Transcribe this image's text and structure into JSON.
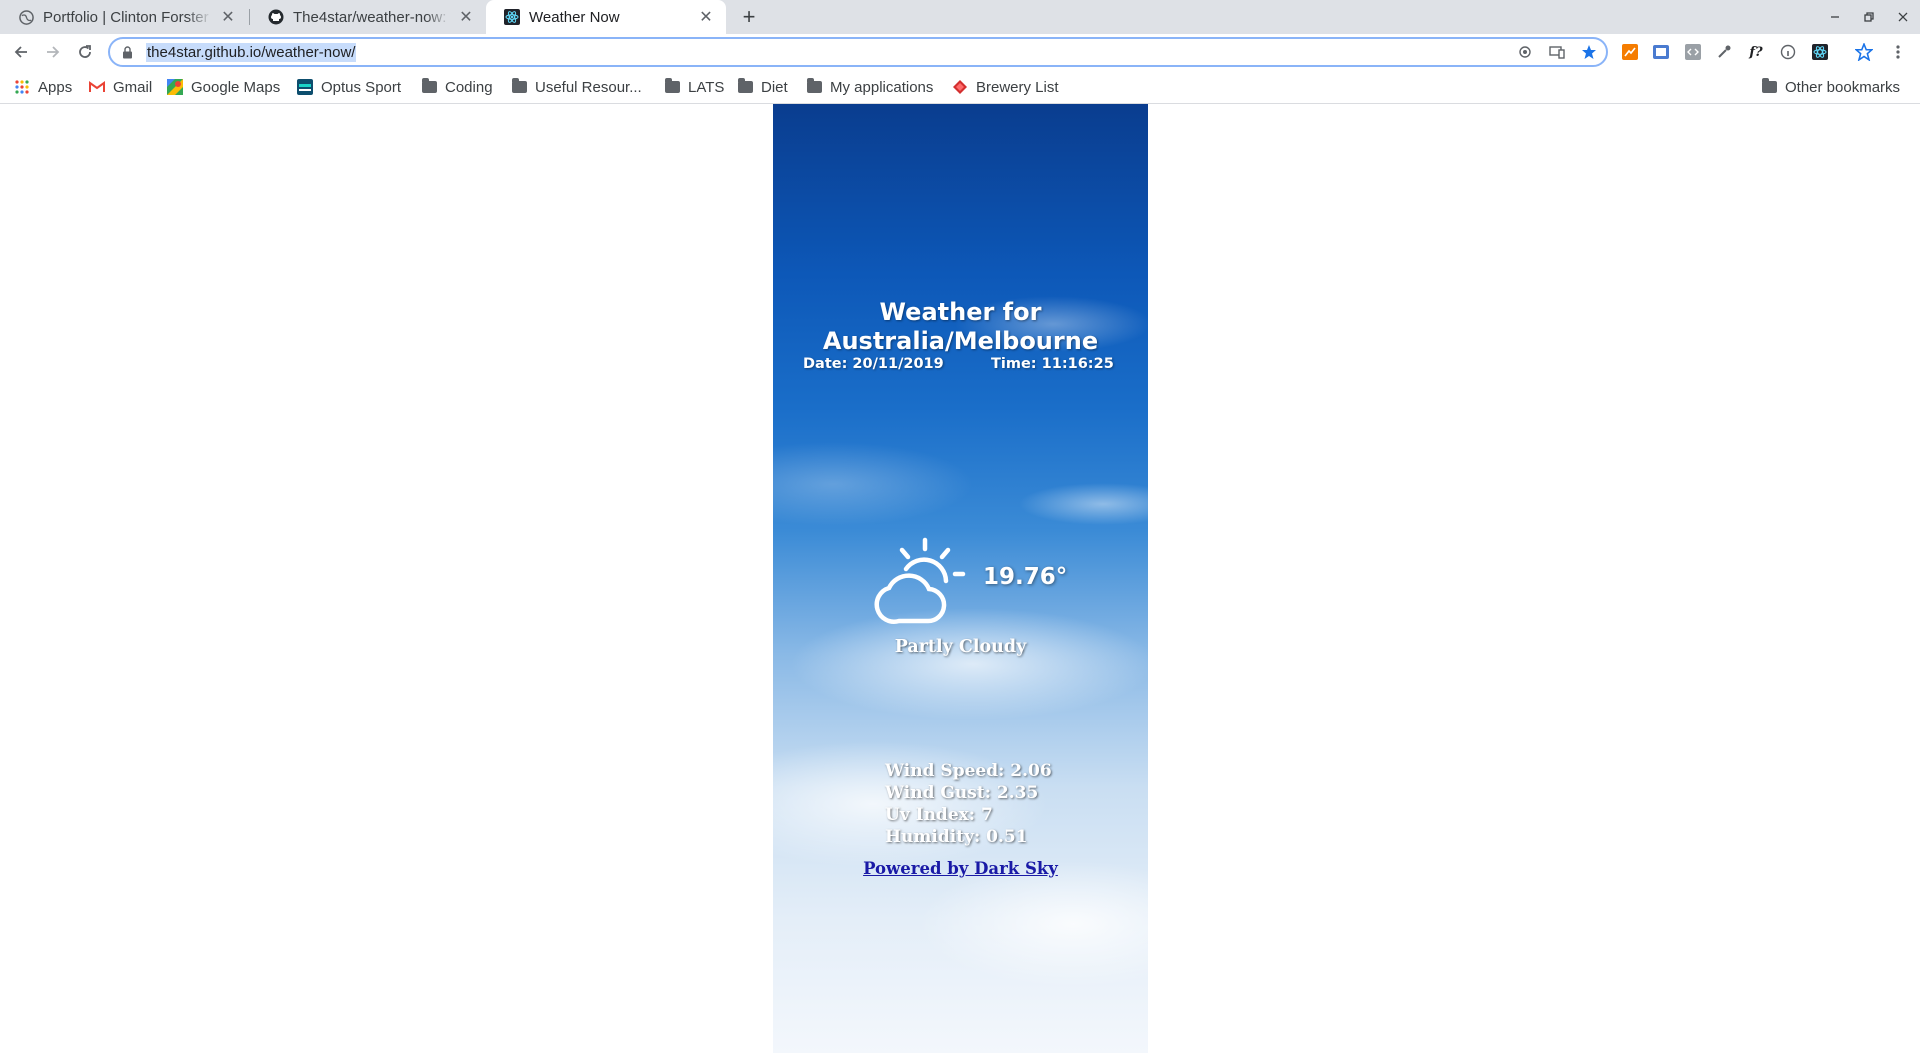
{
  "browser": {
    "tabs": [
      {
        "title": "Portfolio | Clinton Forster",
        "icon": "globe-icon",
        "active": false
      },
      {
        "title": "The4star/weather-now: A",
        "icon": "github-icon",
        "active": false
      },
      {
        "title": "Weather Now",
        "icon": "react-icon",
        "active": true
      }
    ],
    "new_tab_label": "+",
    "url": "the4star.github.io/weather-now/",
    "bookmarks": [
      {
        "label": "Apps",
        "icon": "apps-grid-icon"
      },
      {
        "label": "Gmail",
        "icon": "gmail-icon"
      },
      {
        "label": "Google Maps",
        "icon": "maps-icon"
      },
      {
        "label": "Optus Sport",
        "icon": "optus-icon"
      },
      {
        "label": "Coding",
        "icon": "folder-icon"
      },
      {
        "label": "Useful Resour...",
        "icon": "folder-icon"
      },
      {
        "label": "LATS",
        "icon": "folder-icon"
      },
      {
        "label": "Diet",
        "icon": "folder-icon"
      },
      {
        "label": "My applications",
        "icon": "folder-icon"
      },
      {
        "label": "Brewery List",
        "icon": "diamond-icon"
      }
    ],
    "other_bookmarks": "Other bookmarks"
  },
  "weather": {
    "title": "Weather for Australia/Melbourne",
    "date": "Date: 20/11/2019",
    "time": "Time: 11:16:25",
    "temperature": "19.76°",
    "summary": "Partly Cloudy",
    "icon": "partly-cloudy-icon",
    "wind_speed": "Wind Speed: 2.06",
    "wind_gust": "Wind Gust: 2.35",
    "uv_index": "Uv Index: 7",
    "humidity": "Humidity: 0.51",
    "powered_by": "Powered by Dark Sky"
  },
  "colors": {
    "link": "#1a1aa6",
    "sky_top": "#0a3d8f",
    "sky_bottom": "#f3f7fc"
  }
}
